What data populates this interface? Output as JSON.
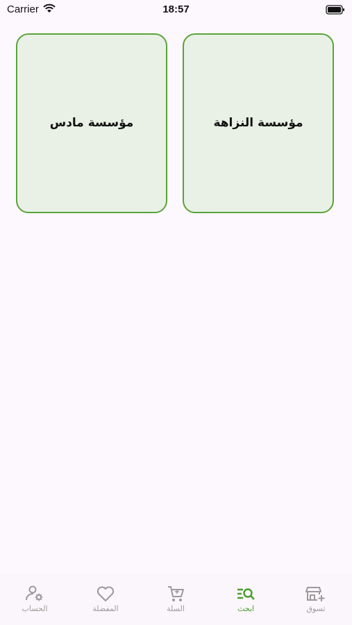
{
  "status": {
    "carrier": "Carrier",
    "time": "18:57"
  },
  "stores": [
    {
      "name": "مؤسسة النزاهة"
    },
    {
      "name": "مؤسسة مادس"
    }
  ],
  "tabs": {
    "shop": "تسوق",
    "search": "ابحث",
    "cart": "السلة",
    "favorites": "المفضلة",
    "account": "الحساب",
    "active": "search"
  },
  "colors": {
    "accent": "#4a9c2a",
    "card_bg": "#e9f1e6",
    "inactive": "#9a9a9a"
  }
}
